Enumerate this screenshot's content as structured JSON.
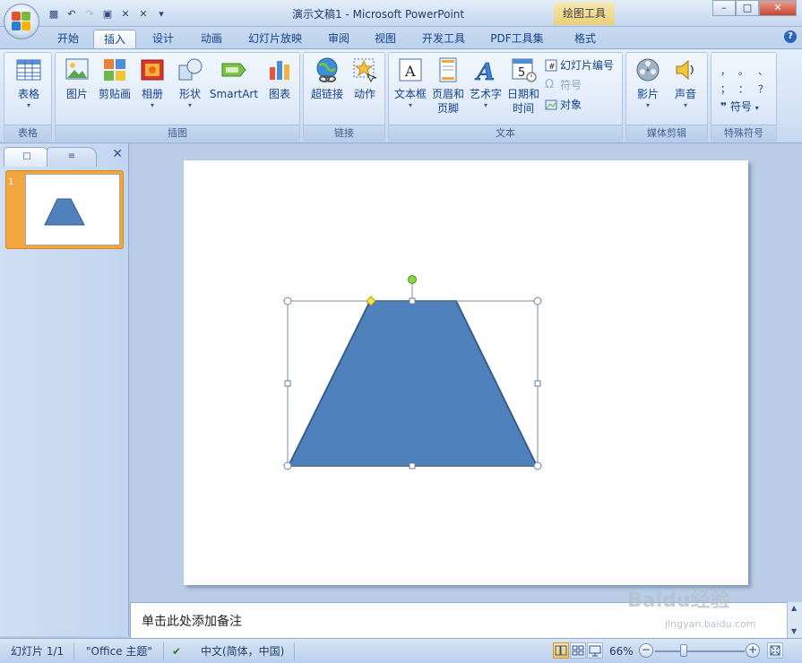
{
  "window": {
    "title": "演示文稿1 - Microsoft PowerPoint",
    "context_tab_title": "绘图工具",
    "controls": {
      "minimize": "–",
      "maximize": "□",
      "close": "✕"
    }
  },
  "tabs": [
    {
      "label": "开始"
    },
    {
      "label": "插入",
      "active": true
    },
    {
      "label": "设计"
    },
    {
      "label": "动画"
    },
    {
      "label": "幻灯片放映"
    },
    {
      "label": "审阅"
    },
    {
      "label": "视图"
    },
    {
      "label": "开发工具"
    },
    {
      "label": "PDF工具集"
    },
    {
      "label": "格式"
    }
  ],
  "ribbon": {
    "groups": {
      "table": {
        "label": "表格",
        "buttons": [
          "表格"
        ]
      },
      "illustrations": {
        "label": "插图",
        "buttons": [
          "图片",
          "剪贴画",
          "相册",
          "形状",
          "SmartArt",
          "图表"
        ]
      },
      "links": {
        "label": "链接",
        "buttons": [
          "超链接",
          "动作"
        ]
      },
      "text": {
        "label": "文本",
        "buttons": [
          "文本框",
          "页眉和",
          "页脚",
          "艺术字",
          "日期和",
          "时间"
        ],
        "small_buttons": [
          "幻灯片编号",
          "符号",
          "对象"
        ]
      },
      "media": {
        "label": "媒体剪辑",
        "buttons": [
          "影片",
          "声音"
        ]
      },
      "special_symbols": {
        "label": "特殊符号",
        "symbol_button": "符号",
        "symbols": [
          "，",
          "。",
          "、",
          "；",
          "：",
          "？"
        ]
      }
    }
  },
  "thumbnail": {
    "number": "1"
  },
  "notes": {
    "placeholder": "单击此处添加备注"
  },
  "watermark": {
    "text": "Baidu经验",
    "url": "jingyan.baidu.com"
  },
  "statusbar": {
    "slide": "幻灯片 1/1",
    "theme": "\"Office 主题\"",
    "language": "中文(简体，中国)",
    "zoom": "66%",
    "zoom_value": 66
  },
  "colors": {
    "shape_fill": "#4f81bd",
    "shape_stroke": "#385d8a",
    "accent_active": "#f2a640"
  }
}
